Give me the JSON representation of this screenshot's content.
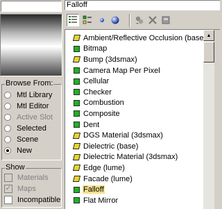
{
  "name_field": {
    "value": "Falloff"
  },
  "toolbar": {
    "buttons": [
      {
        "icon": "list-view-icon",
        "active": true
      },
      {
        "icon": "small-icons-icon"
      },
      {
        "icon": "small-sphere-icon"
      },
      {
        "icon": "large-sphere-icon"
      },
      {
        "icon": "update-scene-icon"
      },
      {
        "icon": "delete-icon"
      },
      {
        "icon": "clear-icon"
      }
    ]
  },
  "browse_from": {
    "label": "Browse From:",
    "options": [
      {
        "label": "Mtl Library",
        "selected": false,
        "disabled": false
      },
      {
        "label": "Mtl Editor",
        "selected": false,
        "disabled": false
      },
      {
        "label": "Active Slot",
        "selected": false,
        "disabled": true
      },
      {
        "label": "Selected",
        "selected": false,
        "disabled": false
      },
      {
        "label": "Scene",
        "selected": false,
        "disabled": false
      },
      {
        "label": "New",
        "selected": true,
        "disabled": false
      }
    ]
  },
  "show": {
    "label": "Show",
    "options": [
      {
        "label": "Materials",
        "checked": false,
        "disabled": true
      },
      {
        "label": "Maps",
        "checked": true,
        "disabled": true
      },
      {
        "label": "Incompatible",
        "checked": false,
        "disabled": false
      }
    ]
  },
  "list": {
    "items": [
      {
        "label": "Ambient/Reflective Occlusion (base)",
        "swatch": "yellow"
      },
      {
        "label": "Bitmap",
        "swatch": "green"
      },
      {
        "label": "Bump (3dsmax)",
        "swatch": "yellow"
      },
      {
        "label": "Camera Map Per Pixel",
        "swatch": "green"
      },
      {
        "label": "Cellular",
        "swatch": "green"
      },
      {
        "label": "Checker",
        "swatch": "green"
      },
      {
        "label": "Combustion",
        "swatch": "green"
      },
      {
        "label": "Composite",
        "swatch": "green"
      },
      {
        "label": "Dent",
        "swatch": "green"
      },
      {
        "label": "DGS Material (3dsmax)",
        "swatch": "yellow"
      },
      {
        "label": "Dielectric (base)",
        "swatch": "yellow"
      },
      {
        "label": "Dielectric Material (3dsmax)",
        "swatch": "yellow"
      },
      {
        "label": "Edge (lume)",
        "swatch": "yellow"
      },
      {
        "label": "Facade (lume)",
        "swatch": "yellow"
      },
      {
        "label": "Falloff",
        "swatch": "green",
        "selected": true
      },
      {
        "label": "Flat Mirror",
        "swatch": "green"
      }
    ]
  },
  "colors": {
    "map_swatch_green": "#1fb224",
    "mentalray_swatch_yellow": "#e7d52d",
    "selection_highlight": "#f5e18a",
    "panel_bg": "#d4d0c8"
  }
}
